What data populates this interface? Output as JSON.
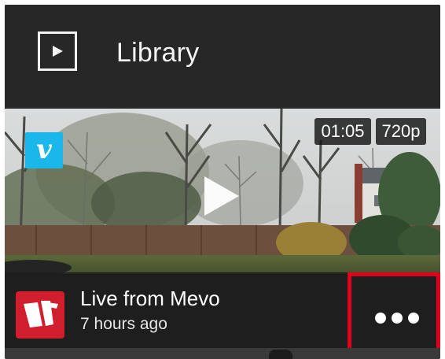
{
  "header": {
    "title": "Library",
    "icon": "play-square-icon"
  },
  "video": {
    "duration": "01:05",
    "resolution": "720p",
    "source_icon": "vimeo-icon",
    "source_letter": "v",
    "play_icon": "play-icon"
  },
  "item": {
    "name": "Live from Mevo",
    "time": "7 hours ago",
    "avatar_icon": "mevo-logo-icon",
    "more_icon": "more-dots-icon"
  },
  "colors": {
    "background": "#2b2b2b",
    "vimeo": "#1ab7ea",
    "mevo": "#d01e2c",
    "highlight": "#e0001b"
  }
}
